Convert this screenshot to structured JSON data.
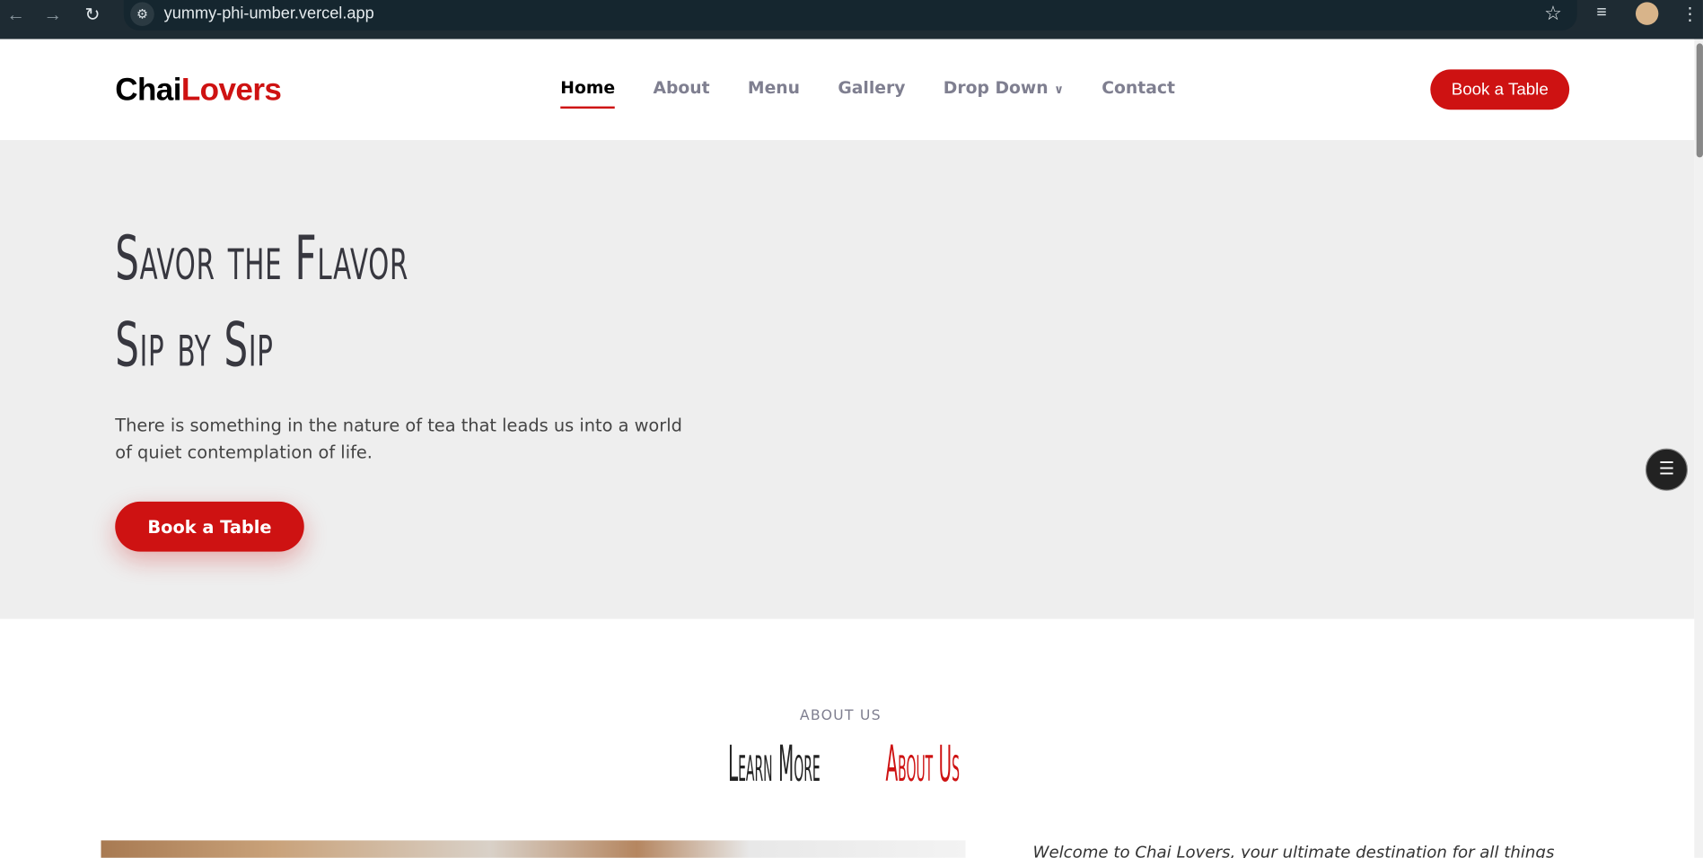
{
  "browser": {
    "url": "yummy-phi-umber.vercel.app"
  },
  "header": {
    "logo_part1": "Chai",
    "logo_part2": "Lovers",
    "nav": [
      {
        "label": "Home",
        "active": true
      },
      {
        "label": "About"
      },
      {
        "label": "Menu"
      },
      {
        "label": "Gallery"
      },
      {
        "label": "Drop Down"
      },
      {
        "label": "Contact"
      }
    ],
    "book_label": "Book a Table"
  },
  "hero": {
    "title_line1": "Savor the Flavor",
    "title_line2": "Sip by Sip",
    "text": "There is something in the nature of tea that leads us into a world of quiet contemplation of life.",
    "button": "Book a Table"
  },
  "about": {
    "tag": "ABOUT US",
    "title_part1": "Learn More",
    "title_part2": "About Us",
    "intro": "Welcome to Chai Lovers, your ultimate destination for all things"
  },
  "colors": {
    "accent": "#ce1212",
    "hero_bg": "#eeeeee"
  }
}
